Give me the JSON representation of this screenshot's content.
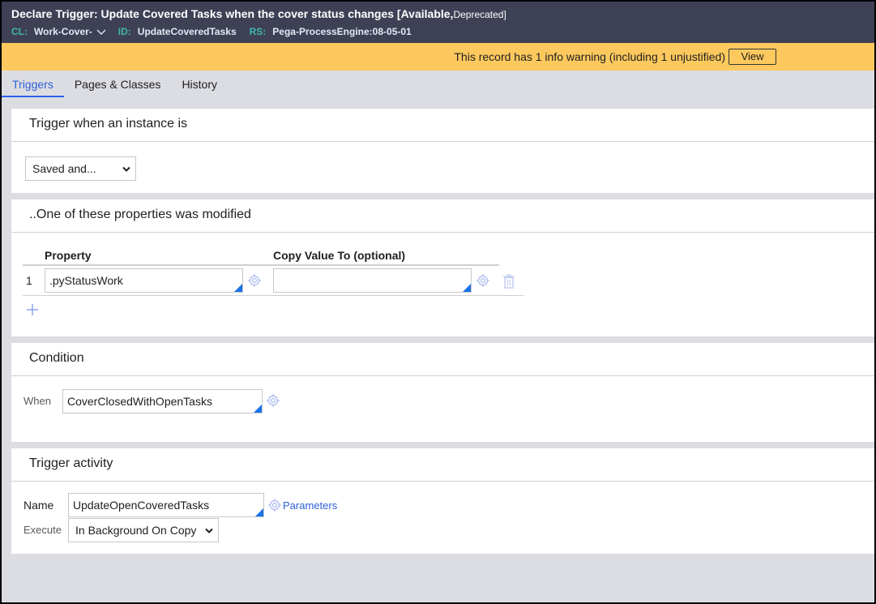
{
  "header": {
    "rule_type": "Declare Trigger:",
    "title": "Update Covered Tasks when the cover status changes",
    "status_available": "[Available,",
    "status_deprecated": "Deprecated]",
    "cl_label": "CL:",
    "cl_value": "Work-Cover-",
    "id_label": "ID:",
    "id_value": "UpdateCoveredTasks",
    "rs_label": "RS:",
    "rs_value": "Pega-ProcessEngine:08-05-01"
  },
  "warning": {
    "message": "This record has 1 info warning (including 1 unjustified)",
    "view_label": "View"
  },
  "tabs": [
    {
      "label": "Triggers",
      "active": true
    },
    {
      "label": "Pages & Classes",
      "active": false
    },
    {
      "label": "History",
      "active": false
    }
  ],
  "sections": {
    "trigger_when": {
      "title": "Trigger when an instance is",
      "selected": "Saved and..."
    },
    "properties": {
      "title": "..One of these properties was modified",
      "columns": [
        "Property",
        "Copy Value To (optional)"
      ],
      "rows": [
        {
          "num": "1",
          "property": ".pyStatusWork",
          "copy_to": ""
        }
      ]
    },
    "condition": {
      "title": "Condition",
      "when_label": "When",
      "when_value": "CoverClosedWithOpenTasks"
    },
    "activity": {
      "title": "Trigger activity",
      "name_label": "Name",
      "name_value": "UpdateOpenCoveredTasks",
      "parameters_label": "Parameters",
      "execute_label": "Execute",
      "execute_value": "In Background On Copy"
    }
  },
  "colors": {
    "header_bg": "#3e4156",
    "warning_bg": "#fdc95e",
    "accent": "#2d60d6",
    "meta_key": "#40b5ae"
  }
}
